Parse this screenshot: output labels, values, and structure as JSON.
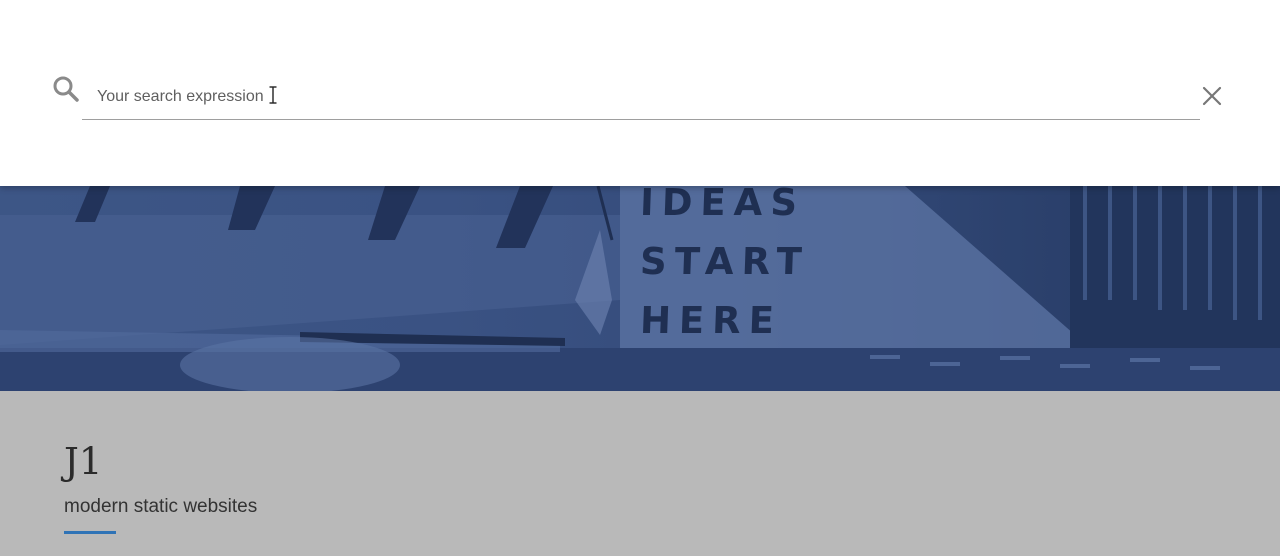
{
  "search": {
    "placeholder": "Your search expression"
  },
  "hero": {
    "sign_lines": [
      "IDEAS",
      "START",
      "HERE"
    ]
  },
  "site": {
    "title": "J1",
    "tagline": "modern static websites"
  },
  "colors": {
    "hero_tint": "#3a5283",
    "content_bg": "#b9b9b9",
    "accent": "#2f73b6"
  },
  "icons": {
    "search": "search-icon",
    "close": "close-icon",
    "cursor": "text-cursor-icon"
  }
}
